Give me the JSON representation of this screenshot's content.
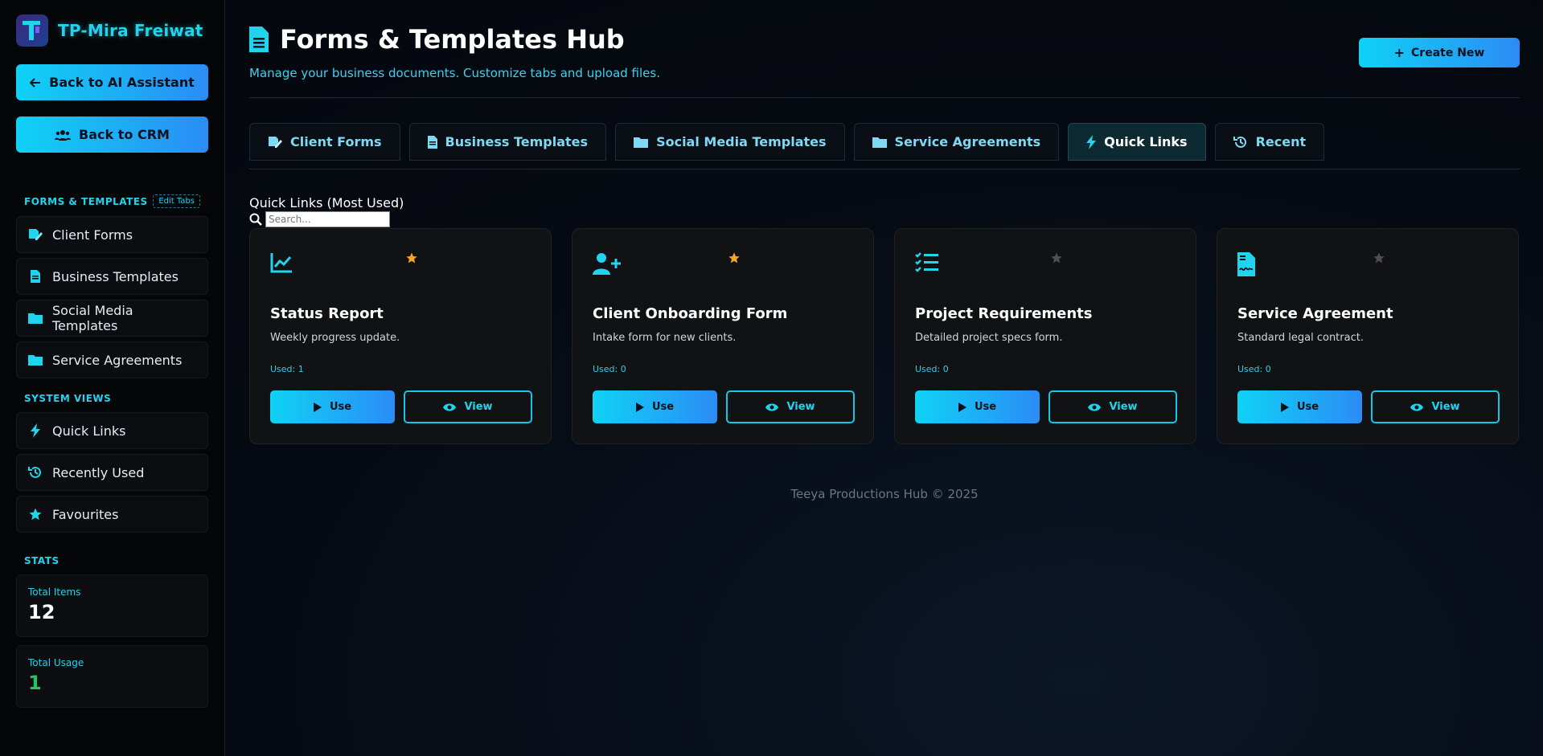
{
  "brand": {
    "name": "TP-Mira Freiwat"
  },
  "sidebar": {
    "back_ai": "Back to AI Assistant",
    "back_crm": "Back to CRM",
    "forms_section": "FORMS & TEMPLATES",
    "edit_tabs": "Edit Tabs",
    "forms_items": [
      {
        "label": "Client Forms",
        "icon": "file-signature-icon"
      },
      {
        "label": "Business Templates",
        "icon": "file-text-icon"
      },
      {
        "label": "Social Media Templates",
        "icon": "folder-icon"
      },
      {
        "label": "Service Agreements",
        "icon": "folder-icon"
      }
    ],
    "system_section": "SYSTEM VIEWS",
    "system_items": [
      {
        "label": "Quick Links",
        "icon": "bolt-icon"
      },
      {
        "label": "Recently Used",
        "icon": "history-icon"
      },
      {
        "label": "Favourites",
        "icon": "star-icon"
      }
    ],
    "stats_section": "STATS",
    "stats": [
      {
        "label": "Total Items",
        "value": "12",
        "color": "#ffffff"
      },
      {
        "label": "Total Usage",
        "value": "1",
        "color": "#22c55e"
      }
    ]
  },
  "header": {
    "title": "Forms & Templates Hub",
    "subtitle": "Manage your business documents. Customize tabs and upload files.",
    "create_label": "Create New"
  },
  "tabs": [
    {
      "label": "Client Forms",
      "active": false
    },
    {
      "label": "Business Templates",
      "active": false
    },
    {
      "label": "Social Media Templates",
      "active": false
    },
    {
      "label": "Service Agreements",
      "active": false
    },
    {
      "label": "Quick Links",
      "active": true
    },
    {
      "label": "Recent",
      "active": false
    }
  ],
  "content": {
    "section_title": "Quick Links (Most Used)",
    "search_placeholder": "Search..."
  },
  "cards": [
    {
      "icon": "chart-line-icon",
      "title": "Status Report",
      "description": "Weekly progress update.",
      "used": "Used: 1",
      "favourite": true,
      "use_label": "Use",
      "view_label": "View"
    },
    {
      "icon": "user-plus-icon",
      "title": "Client Onboarding Form",
      "description": "Intake form for new clients.",
      "used": "Used: 0",
      "favourite": true,
      "use_label": "Use",
      "view_label": "View"
    },
    {
      "icon": "list-check-icon",
      "title": "Project Requirements",
      "description": "Detailed project specs form.",
      "used": "Used: 0",
      "favourite": false,
      "use_label": "Use",
      "view_label": "View"
    },
    {
      "icon": "file-contract-icon",
      "title": "Service Agreement",
      "description": "Standard legal contract.",
      "used": "Used: 0",
      "favourite": false,
      "use_label": "Use",
      "view_label": "View"
    }
  ],
  "footer": {
    "text": "Teeya Productions Hub © 2025"
  },
  "colors": {
    "accent": "#22d3ee",
    "star_on": "#f5a623",
    "star_off": "#555555"
  }
}
